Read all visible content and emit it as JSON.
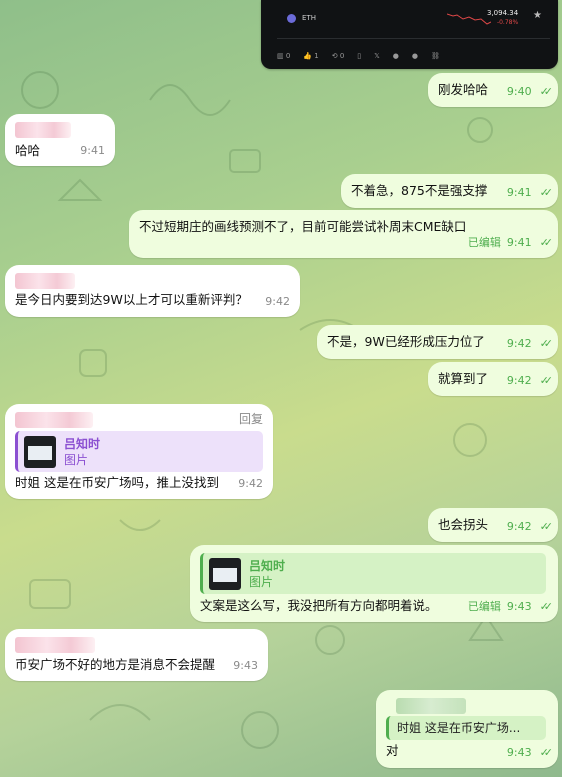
{
  "tweet_card": {
    "coin": "ETH",
    "price": "3,094.34",
    "change": "-0.78%",
    "stats": [
      "0",
      "1",
      "0"
    ]
  },
  "messages": [
    {
      "text": "刚发哈哈",
      "time": "9:40"
    },
    {
      "text": "哈哈",
      "time": "9:41"
    },
    {
      "text": "不着急，875不是强支撑",
      "time": "9:41"
    },
    {
      "text": "不过短期庄的画线预测不了，目前可能尝试补周末CME缺口",
      "edited": "已编辑",
      "time": "9:41"
    },
    {
      "text": "是今日内要到达9W以上才可以重新评判？",
      "time": "9:42"
    },
    {
      "text": "不是，9W已经形成压力位了",
      "time": "9:42"
    },
    {
      "text": "就算到了",
      "time": "9:42"
    },
    {
      "reply_action": "回复",
      "reply_name": "吕知时",
      "reply_sub": "图片",
      "text": "时姐  这是在币安广场吗，推上没找到",
      "time": "9:42"
    },
    {
      "text": "也会拐头",
      "time": "9:42"
    },
    {
      "reply_name": "吕知时",
      "reply_sub": "图片",
      "text": "文案是这么写，我没把所有方向都明着说。",
      "edited": "已编辑",
      "time": "9:43"
    },
    {
      "text": "币安广场不好的地方是消息不会提醒",
      "time": "9:43"
    },
    {
      "reply_text": "时姐  这是在币安广场...",
      "text": "对",
      "time": "9:43"
    }
  ],
  "colors": {
    "outgoing_bubble": "#effdde",
    "incoming_bubble": "#ffffff",
    "accent_green": "#4fae4e",
    "reply_purple": "#8b4fd1",
    "negative_red": "#e04848"
  }
}
